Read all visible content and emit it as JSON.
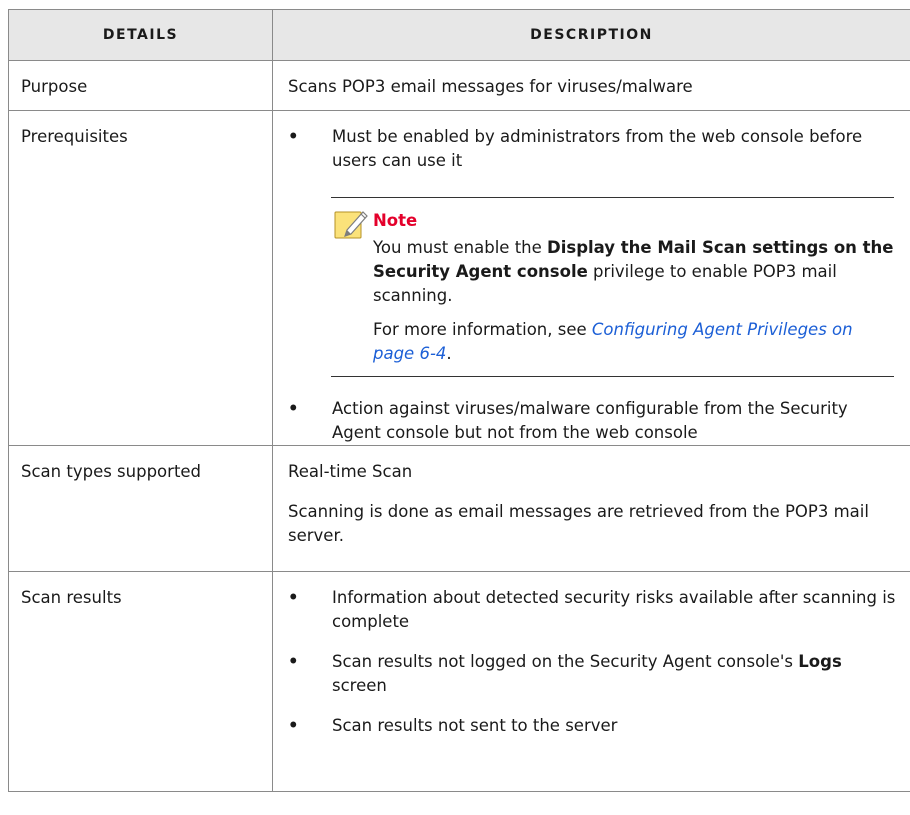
{
  "table": {
    "headers": {
      "details": "Details",
      "description": "Description"
    },
    "purpose": {
      "label": "Purpose",
      "value": "Scans POP3 email messages for viruses/malware"
    },
    "prerequisites": {
      "label": "Prerequisites",
      "bullet_symbol": "•",
      "bullet1": "Must be enabled by administrators from the web console before users can use it",
      "note": {
        "title": "Note",
        "p1_pre": "You must enable the ",
        "p1_bold": "Display the Mail Scan settings on the Security Agent console",
        "p1_post": " privilege to enable POP3 mail scanning.",
        "p2_pre": "For more information, see ",
        "p2_link": "Configuring Agent Privileges on page 6-4",
        "p2_post": "."
      },
      "bullet2": "Action against viruses/malware configurable from the Security Agent console but not from the web console"
    },
    "scan_types": {
      "label": "Scan types supported",
      "p1": "Real-time Scan",
      "p2": "Scanning is done as email messages are retrieved from the POP3 mail server."
    },
    "scan_results": {
      "label": "Scan results",
      "bullet1": "Information about detected security risks available after scanning is complete",
      "bullet2_pre": "Scan results not logged on the Security Agent console's ",
      "bullet2_bold": "Logs",
      "bullet2_post": " screen",
      "bullet3": "Scan results not sent to the server"
    }
  },
  "colors": {
    "note_title": "#e4002b",
    "link": "#1c5fd6",
    "header_bg": "#e7e7e7"
  }
}
